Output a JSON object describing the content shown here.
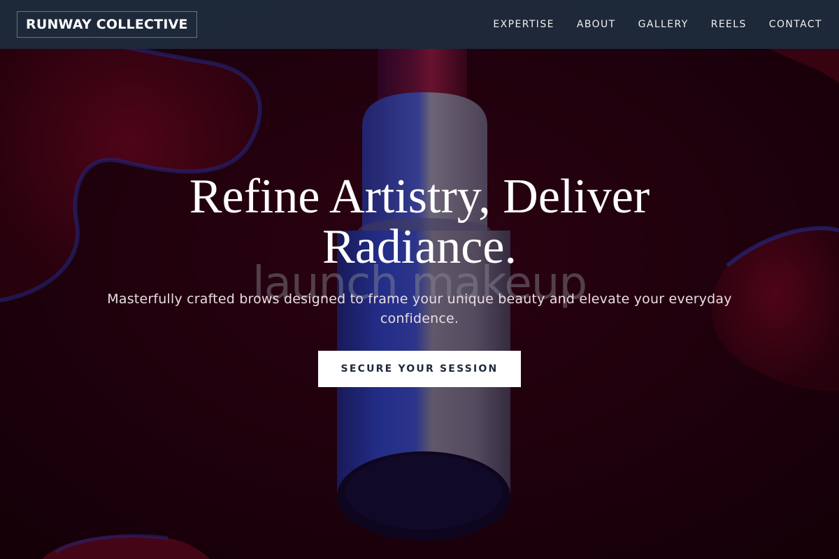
{
  "brand": {
    "logo_text": "RUNWAY COLLECTIVE"
  },
  "nav": {
    "items": [
      {
        "label": "EXPERTISE"
      },
      {
        "label": "ABOUT"
      },
      {
        "label": "GALLERY"
      },
      {
        "label": "REELS"
      },
      {
        "label": "CONTACT"
      }
    ]
  },
  "hero": {
    "headline_line1": "Refine Artistry, Deliver",
    "headline_line2": "Radiance.",
    "image_watermark": "launch makeup",
    "subheading": "Masterfully crafted brows designed to frame your unique beauty and elevate your everyday confidence.",
    "cta_label": "SECURE YOUR SESSION",
    "background_image": "lipstick-tube-on-red-liquid"
  },
  "colors": {
    "navbar_bg": "#1e293b",
    "cta_bg": "#ffffff",
    "cta_text": "#1e293b",
    "hero_base": "#2a000c"
  }
}
